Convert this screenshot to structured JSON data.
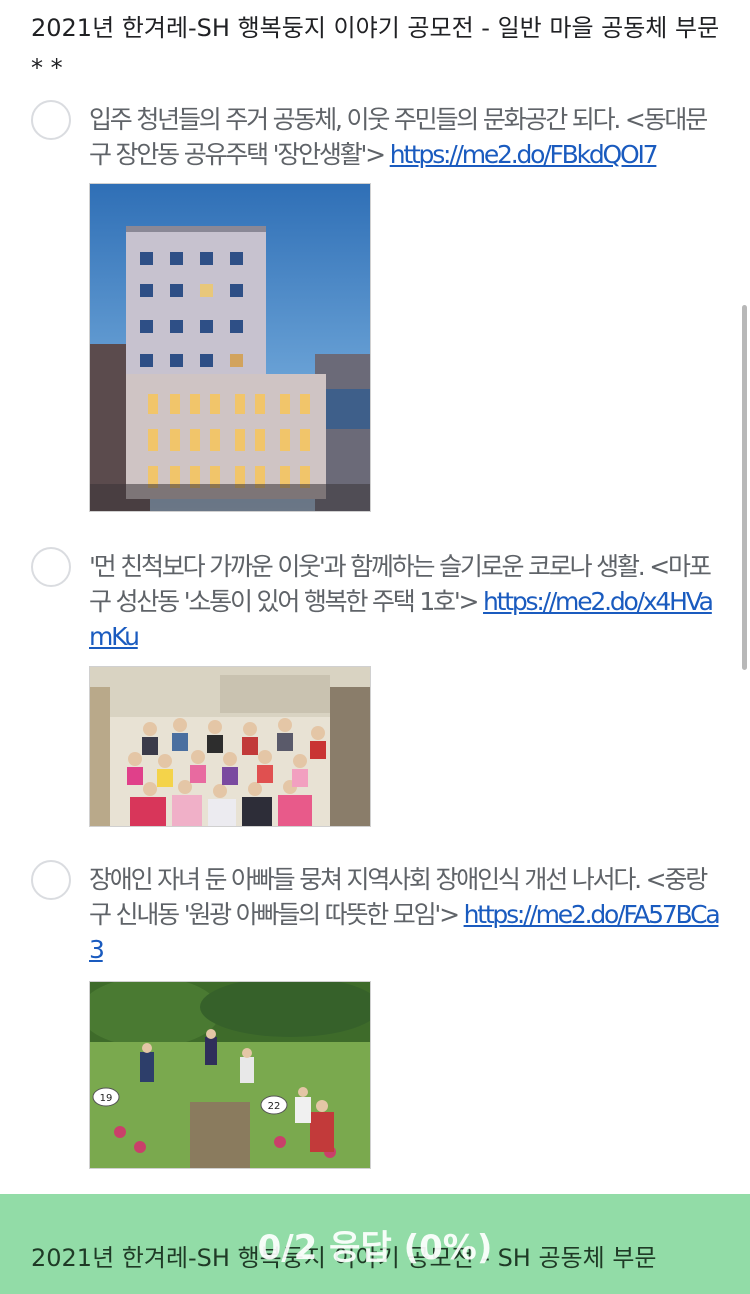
{
  "question": {
    "title": "2021년 한겨레-SH 행복둥지 이야기 공모전 - 일반 마을 공동체 부문*  *"
  },
  "options": [
    {
      "text": "입주 청년들의 주거 공동체, 이웃 주민들의 문화공간 되다. <동대문구 장안동 공유주택 '장안생활'> ",
      "link": "https://me2.do/FBkdQOI7"
    },
    {
      "text": "'먼 친척보다 가까운 이웃'과 함께하는 슬기로운 코로나 생활. <마포구 성산동 '소통이 있어 행복한 주택 1호'> ",
      "link": "https://me2.do/x4HVamKu"
    },
    {
      "text": "장애인 자녀 둔 아빠들 뭉쳐 지역사회 장애인식 개선 나서다. <중랑구 신내동 '원광 아빠들의 따뜻한 모임'> ",
      "link": "https://me2.do/FA57BCa3",
      "photo_labels": [
        "19",
        "22"
      ]
    }
  ],
  "progress": {
    "label": "0/2 응답 (0%)",
    "answered": 0,
    "total": 2,
    "percent": 0
  },
  "next_question": {
    "title": "2021년 한겨레-SH 행복둥지 이야기 공모전 - SH 공동체 부문"
  },
  "colors": {
    "progress_bar": "#8edba4",
    "link": "#1a5bbf",
    "option_text": "#5f6368"
  }
}
